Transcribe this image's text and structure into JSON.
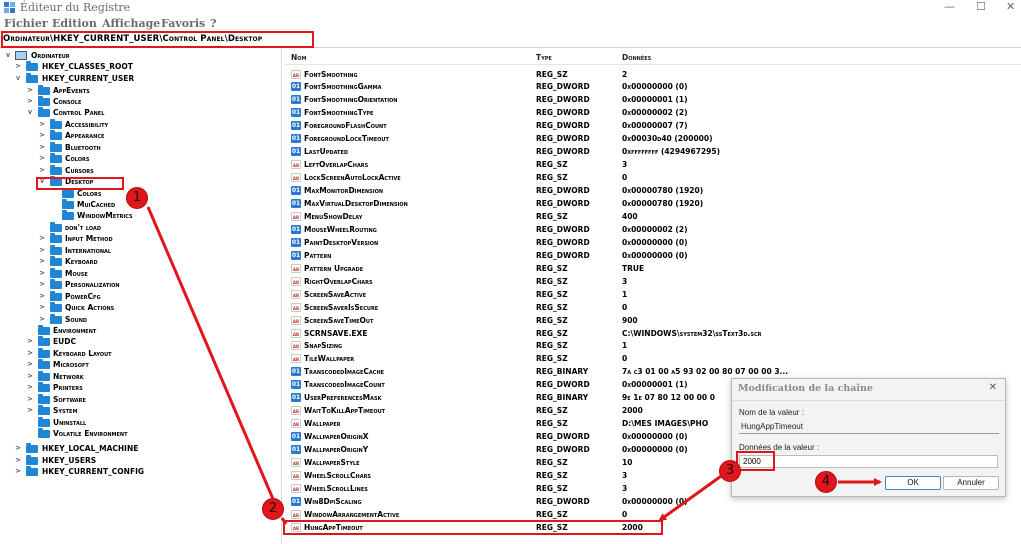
{
  "window": {
    "title": "Éditeur du Registre",
    "minimize": "—",
    "maximize": "☐",
    "close": "✕"
  },
  "menu": [
    "Fichier",
    "Edition",
    "Affichage",
    "Favoris",
    "?"
  ],
  "address": "Ordinateur\\HKEY_CURRENT_USER\\Control Panel\\Desktop",
  "tree": {
    "root": "Ordinateur",
    "hives": {
      "classes_root": "HKEY_CLASSES_ROOT",
      "current_user": "HKEY_CURRENT_USER",
      "local_machine": "HKEY_LOCAL_MACHINE",
      "users": "HKEY_USERS",
      "current_config": "HKEY_CURRENT_CONFIG"
    },
    "hkcu_children_top": [
      "AppEvents",
      "Console",
      "Control Panel"
    ],
    "control_panel_children_top": [
      "Accessibility",
      "Appearance",
      "Bluetooth",
      "Colors",
      "Cursors",
      "Desktop"
    ],
    "desktop_children": [
      "Colors",
      "MuiCached",
      "WindowMetrics"
    ],
    "control_panel_children_bottom": [
      "don't load",
      "Input Method",
      "International",
      "Keyboard",
      "Mouse",
      "Personalization",
      "PowerCfg",
      "Quick Actions",
      "Sound"
    ],
    "hkcu_children_bottom": [
      "Environment",
      "EUDC",
      "Keyboard Layout",
      "Microsoft",
      "Network",
      "Printers",
      "Software",
      "System",
      "Uninstall",
      "Volatile Environment"
    ]
  },
  "list": {
    "headers": {
      "name": "Nom",
      "type": "Type",
      "data": "Données"
    },
    "rows": [
      {
        "name": "FontSmoothing",
        "type": "REG_SZ",
        "data": "2"
      },
      {
        "name": "FontSmoothingGamma",
        "type": "REG_DWORD",
        "data": "0x00000000 (0)"
      },
      {
        "name": "FontSmoothingOrientation",
        "type": "REG_DWORD",
        "data": "0x00000001 (1)"
      },
      {
        "name": "FontSmoothingType",
        "type": "REG_DWORD",
        "data": "0x00000002 (2)"
      },
      {
        "name": "ForegroundFlashCount",
        "type": "REG_DWORD",
        "data": "0x00000007 (7)"
      },
      {
        "name": "ForegroundLockTimeout",
        "type": "REG_DWORD",
        "data": "0x00030d40 (200000)"
      },
      {
        "name": "LastUpdated",
        "type": "REG_DWORD",
        "data": "0xffffffff (4294967295)"
      },
      {
        "name": "LeftOverlapChars",
        "type": "REG_SZ",
        "data": "3"
      },
      {
        "name": "LockScreenAutoLockActive",
        "type": "REG_SZ",
        "data": "0"
      },
      {
        "name": "MaxMonitorDimension",
        "type": "REG_DWORD",
        "data": "0x00000780 (1920)"
      },
      {
        "name": "MaxVirtualDesktopDimension",
        "type": "REG_DWORD",
        "data": "0x00000780 (1920)"
      },
      {
        "name": "MenuShowDelay",
        "type": "REG_SZ",
        "data": "400"
      },
      {
        "name": "MouseWheelRouting",
        "type": "REG_DWORD",
        "data": "0x00000002 (2)"
      },
      {
        "name": "PaintDesktopVersion",
        "type": "REG_DWORD",
        "data": "0x00000000 (0)"
      },
      {
        "name": "Pattern",
        "type": "REG_DWORD",
        "data": "0x00000000 (0)"
      },
      {
        "name": "Pattern Upgrade",
        "type": "REG_SZ",
        "data": "TRUE"
      },
      {
        "name": "RightOverlapChars",
        "type": "REG_SZ",
        "data": "3"
      },
      {
        "name": "ScreenSaveActive",
        "type": "REG_SZ",
        "data": "1"
      },
      {
        "name": "ScreenSaverIsSecure",
        "type": "REG_SZ",
        "data": "0"
      },
      {
        "name": "ScreenSaveTimeOut",
        "type": "REG_SZ",
        "data": "900"
      },
      {
        "name": "SCRNSAVE.EXE",
        "type": "REG_SZ",
        "data": "C:\\WINDOWS\\system32\\ssText3d.scr"
      },
      {
        "name": "SnapSizing",
        "type": "REG_SZ",
        "data": "1"
      },
      {
        "name": "TileWallpaper",
        "type": "REG_SZ",
        "data": "0"
      },
      {
        "name": "TranscodedImageCache",
        "type": "REG_BINARY",
        "data": "7a c3 01 00 a5 93 02 00 80 07 00 00 3..."
      },
      {
        "name": "TranscodedImageCount",
        "type": "REG_DWORD",
        "data": "0x00000001 (1)"
      },
      {
        "name": "UserPreferencesMask",
        "type": "REG_BINARY",
        "data": "9e 1e 07 80 12 00 00 0"
      },
      {
        "name": "WaitToKillAppTimeout",
        "type": "REG_SZ",
        "data": "2000"
      },
      {
        "name": "Wallpaper",
        "type": "REG_SZ",
        "data": "D:\\MES IMAGES\\PHO"
      },
      {
        "name": "WallpaperOriginX",
        "type": "REG_DWORD",
        "data": "0x00000000 (0)"
      },
      {
        "name": "WallpaperOriginY",
        "type": "REG_DWORD",
        "data": "0x00000000 (0)"
      },
      {
        "name": "WallpaperStyle",
        "type": "REG_SZ",
        "data": "10"
      },
      {
        "name": "WheelScrollChars",
        "type": "REG_SZ",
        "data": "3"
      },
      {
        "name": "WheelScrollLines",
        "type": "REG_SZ",
        "data": "3"
      },
      {
        "name": "Win8DpiScaling",
        "type": "REG_DWORD",
        "data": "0x00000000 (0)"
      },
      {
        "name": "WindowArrangementActive",
        "type": "REG_SZ",
        "data": "0"
      },
      {
        "name": "HungAppTimeout",
        "type": "REG_SZ",
        "data": "2000"
      }
    ]
  },
  "dialog": {
    "title": "Modification de la chaîne",
    "close": "✕",
    "name_label": "Nom de la valeur :",
    "name_value": "HungAppTimeout",
    "data_label": "Données de la valeur :",
    "data_value": "2000",
    "ok": "OK",
    "cancel": "Annuler"
  },
  "steps": [
    "1",
    "2",
    "3",
    "4"
  ],
  "colors": {
    "annotation": "#e0161a",
    "folder": "#1f86d6"
  }
}
